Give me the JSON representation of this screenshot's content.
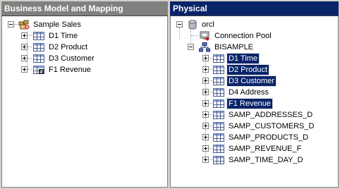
{
  "left_pane": {
    "title": "Business Model and Mapping",
    "root": {
      "label": "Sample Sales",
      "icon": "business-model-icon"
    },
    "children": [
      {
        "label": "D1 Time",
        "icon": "logical-table-icon"
      },
      {
        "label": "D2 Product",
        "icon": "logical-table-icon"
      },
      {
        "label": "D3 Customer",
        "icon": "logical-table-icon"
      },
      {
        "label": "F1 Revenue",
        "icon": "fact-table-icon"
      }
    ]
  },
  "right_pane": {
    "title": "Physical",
    "root": {
      "label": "orcl",
      "icon": "database-icon"
    },
    "connection_pool": {
      "label": "Connection Pool",
      "icon": "connection-pool-icon"
    },
    "schema": {
      "label": "BISAMPLE",
      "icon": "schema-icon"
    },
    "tables": [
      {
        "label": "D1 Time",
        "selected": true
      },
      {
        "label": "D2 Product",
        "selected": true
      },
      {
        "label": "D3 Customer",
        "selected": true
      },
      {
        "label": "D4 Address",
        "selected": false
      },
      {
        "label": "F1 Revenue",
        "selected": true
      },
      {
        "label": "SAMP_ADDRESSES_D",
        "selected": false
      },
      {
        "label": "SAMP_CUSTOMERS_D",
        "selected": false
      },
      {
        "label": "SAMP_PRODUCTS_D",
        "selected": false
      },
      {
        "label": "SAMP_REVENUE_F",
        "selected": false
      },
      {
        "label": "SAMP_TIME_DAY_D",
        "selected": false
      }
    ]
  },
  "colors": {
    "selection": "#0a246a",
    "active_title": "#0a246a",
    "inactive_title": "#808080",
    "panel": "#d4d0c8"
  }
}
